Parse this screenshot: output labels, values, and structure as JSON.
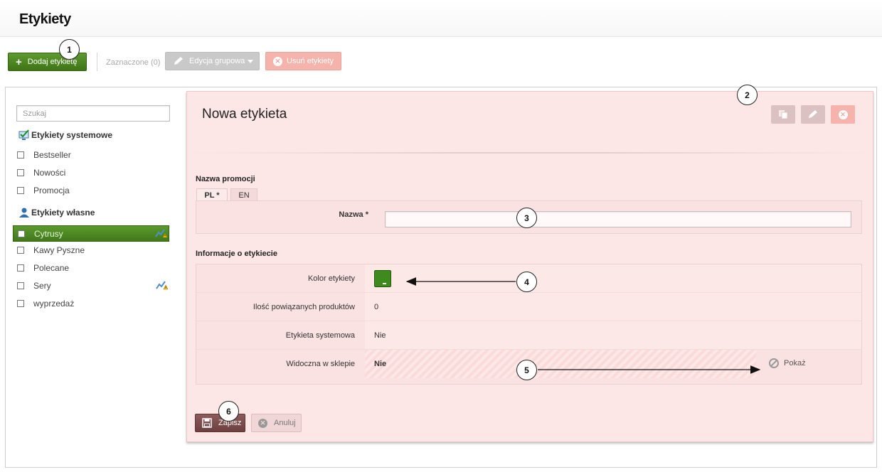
{
  "page": {
    "title": "Etykiety"
  },
  "toolbar": {
    "add_label": "Dodaj etykietę",
    "selected_label": "Zaznaczone (0)",
    "group_edit_label": "Edycja grupowa",
    "delete_label": "Usuń etykiety"
  },
  "sidebar": {
    "search_placeholder": "Szukaj",
    "system_group": "Etykiety systemowe",
    "system_items": [
      {
        "label": "Bestseller"
      },
      {
        "label": "Nowości"
      },
      {
        "label": "Promocja"
      }
    ],
    "own_group": "Etykiety własne",
    "own_items": [
      {
        "label": "Cytrusy",
        "active": true,
        "icon": "chart-warning-icon"
      },
      {
        "label": "Kawy Pyszne"
      },
      {
        "label": "Polecane"
      },
      {
        "label": "Sery",
        "icon": "chart-warning-icon"
      },
      {
        "label": "wyprzedaż"
      }
    ]
  },
  "panel": {
    "title": "Nowa etykieta",
    "section_name": "Nazwa promocji",
    "tabs": [
      {
        "label": "PL *",
        "active": true
      },
      {
        "label": "EN",
        "active": false
      }
    ],
    "name_label": "Nazwa *",
    "name_value": "",
    "section_info": "Informacje o etykiecie",
    "info_rows": [
      {
        "label": "Kolor etykiety",
        "value": ""
      },
      {
        "label": "Ilość powiązanych produktów",
        "value": "0"
      },
      {
        "label": "Etykieta systemowa",
        "value": "Nie"
      },
      {
        "label": "Widoczna w sklepie",
        "value": "Nie",
        "action": "Pokaż"
      }
    ],
    "label_color": "#3e8a1c",
    "save_label": "Zapisz",
    "cancel_label": "Anuluj"
  },
  "callouts": [
    "1",
    "2",
    "3",
    "4",
    "5",
    "6"
  ]
}
